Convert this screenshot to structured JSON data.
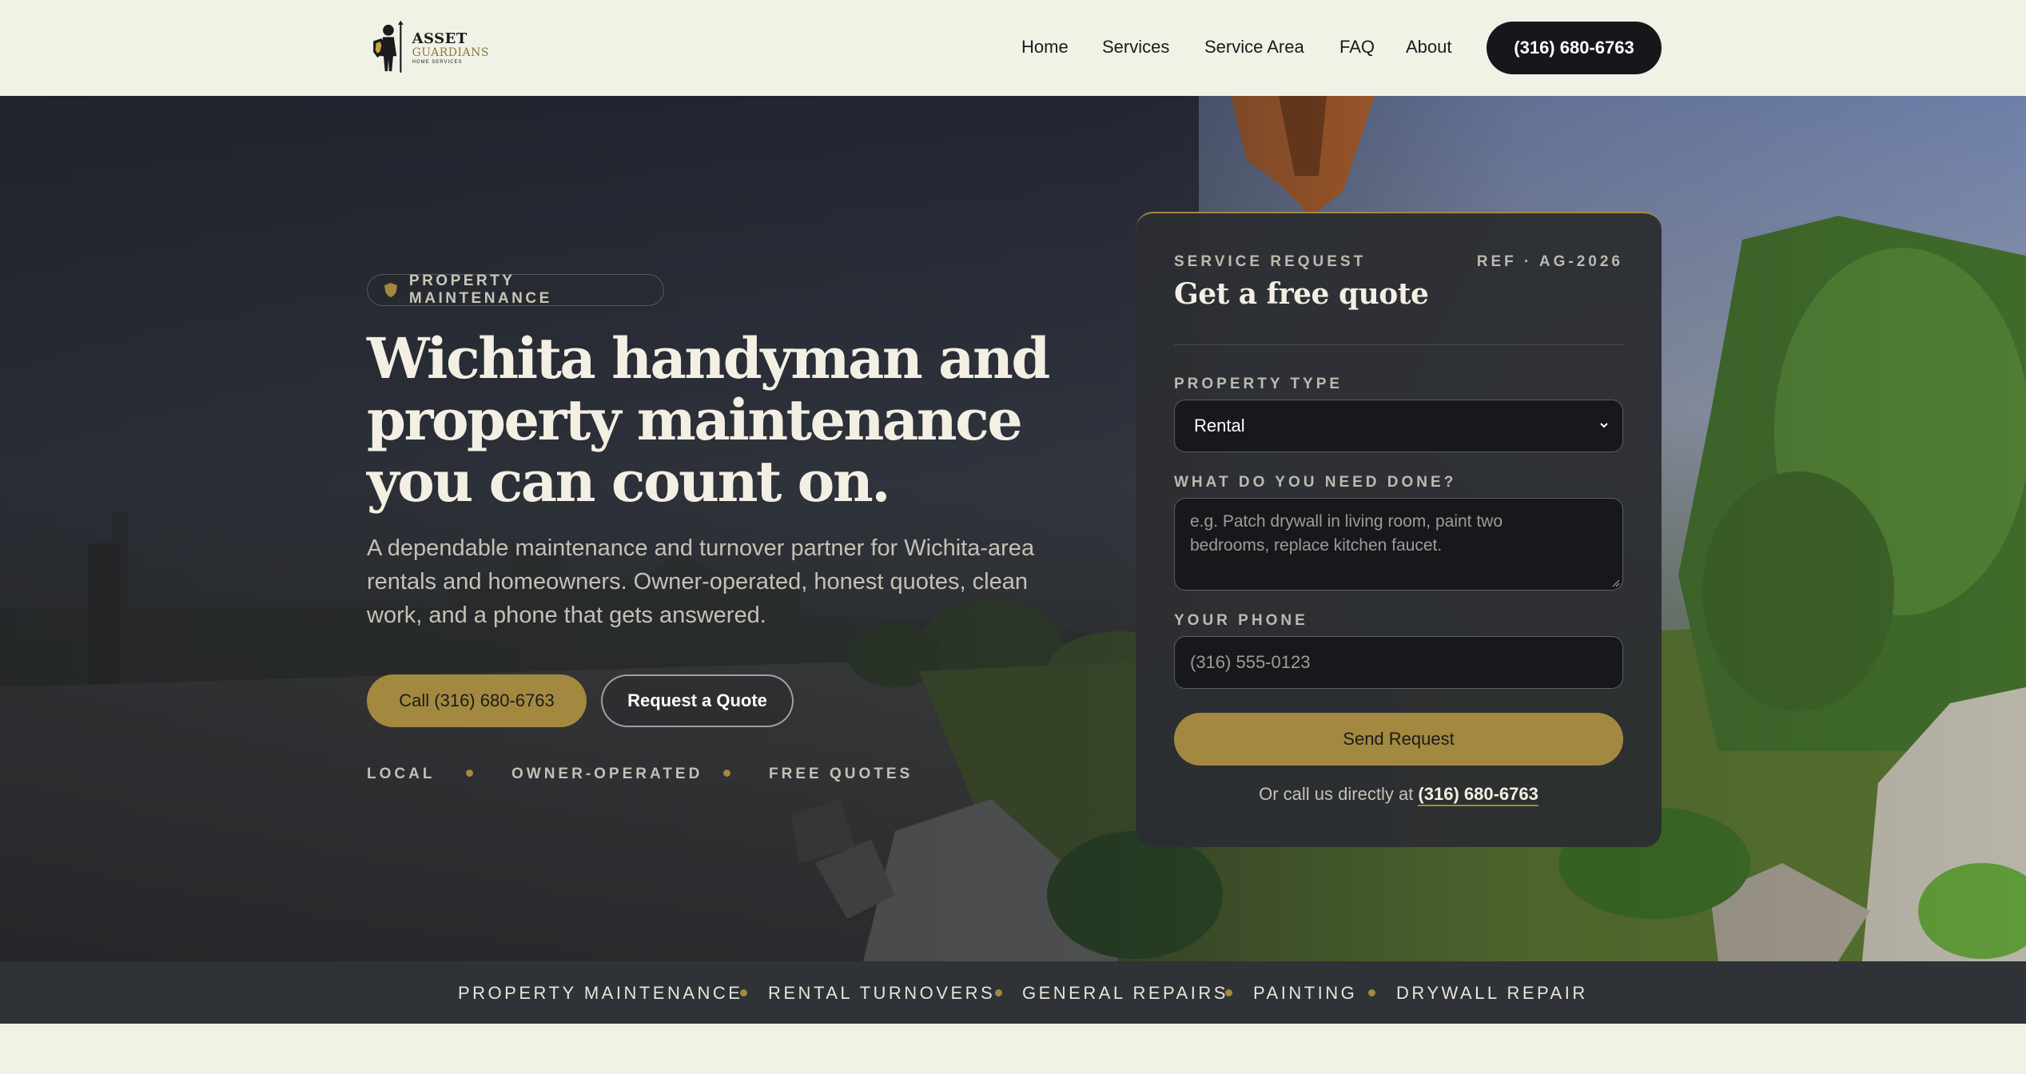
{
  "brand": {
    "logo_line1": "ASSET",
    "logo_line2": "GUARDIANS",
    "logo_line3": "HOME SERVICES"
  },
  "nav": {
    "items": [
      {
        "label": "Home"
      },
      {
        "label": "Services"
      },
      {
        "label": "Service Area"
      },
      {
        "label": "FAQ"
      },
      {
        "label": "About"
      }
    ],
    "call_label": "(316) 680-6763"
  },
  "hero": {
    "badge": "PROPERTY MAINTENANCE",
    "title_lines": [
      "Wichita handyman and",
      "property maintenance",
      "you can count on."
    ],
    "subtitle_lines": [
      "A dependable maintenance and turnover partner for Wichita-area",
      "rentals and homeowners. Owner-operated, honest quotes, clean",
      "work, and a phone that gets answered."
    ],
    "call_button": "Call (316) 680-6763",
    "quote_button": "Request a Quote",
    "tags": [
      "LOCAL",
      "OWNER-OPERATED",
      "FREE QUOTES"
    ]
  },
  "form": {
    "eyebrow": "SERVICE REQUEST",
    "ref": "REF · AG-2026",
    "title": "Get a free quote",
    "property_type_label": "PROPERTY TYPE",
    "property_type_value": "Rental",
    "need_label": "WHAT DO YOU NEED DONE?",
    "need_placeholder_lines": [
      "e.g. Patch drywall in living room, paint two",
      "bedrooms, replace kitchen faucet."
    ],
    "phone_label": "YOUR PHONE",
    "phone_placeholder": "(316) 555-0123",
    "submit": "Send Request",
    "footer_prefix": "Or call us directly at",
    "footer_phone": "(316) 680-6763"
  },
  "services_strip": [
    "PROPERTY MAINTENANCE",
    "RENTAL TURNOVERS",
    "GENERAL REPAIRS",
    "PAINTING",
    "DRYWALL REPAIR"
  ],
  "colors": {
    "accent_gold": "#a3893f",
    "page_bg": "#f1f2e6",
    "dark": "#16171a",
    "card_bg": "#2c2e32",
    "strip_bg": "#2f3236"
  }
}
